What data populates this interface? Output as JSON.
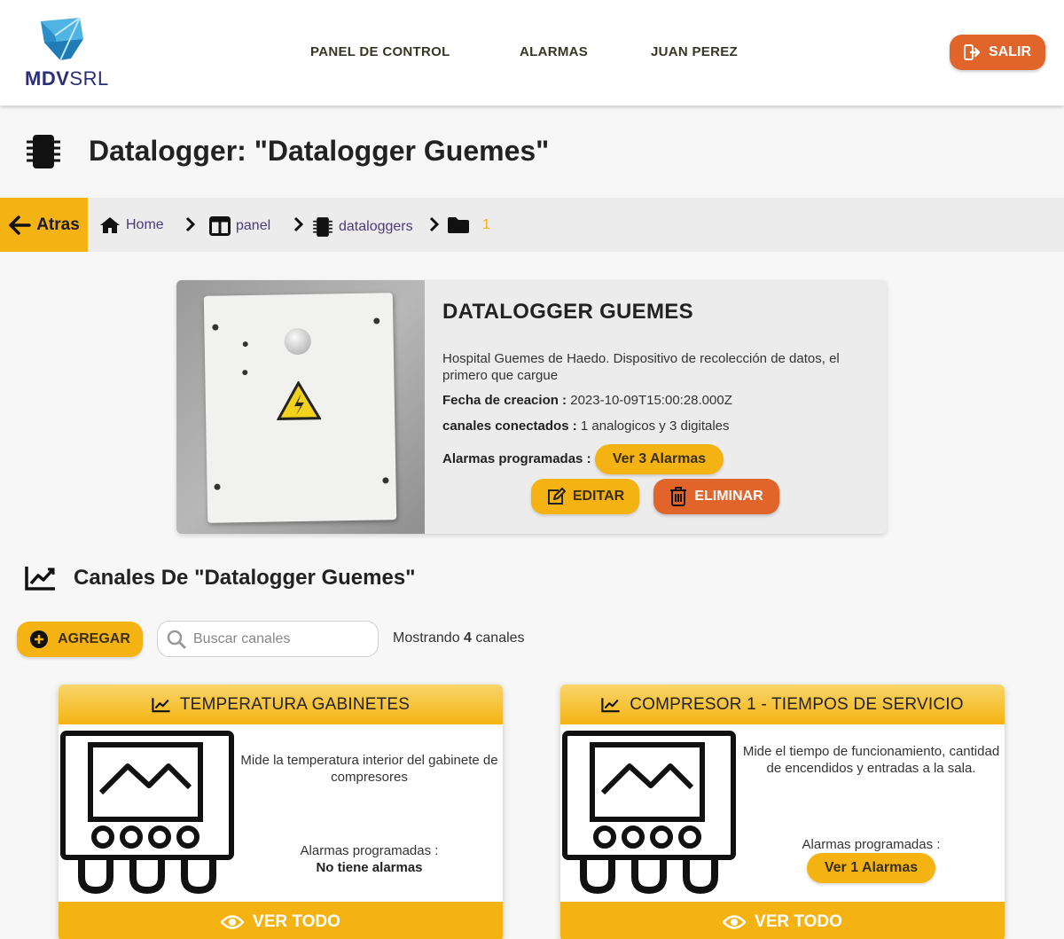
{
  "header": {
    "logo_text_bold": "MDV",
    "logo_text_light": "SRL",
    "nav": [
      "PANEL DE CONTROL",
      "ALARMAS",
      "JUAN PEREZ"
    ],
    "logout_label": "SALIR"
  },
  "page": {
    "title": "Datalogger: \"Datalogger Guemes\""
  },
  "breadcrumb": {
    "back_label": "Atras",
    "items": [
      "Home",
      "panel",
      "dataloggers",
      "1"
    ]
  },
  "device": {
    "name": "DATALOGGER GUEMES",
    "description": "Hospital Guemes de Haedo. Dispositivo de recolección de datos, el primero que cargue",
    "created_label": "Fecha de creacion :",
    "created_value": "2023-10-09T15:00:28.000Z",
    "channels_label": "canales conectados :",
    "channels_value": "1 analogicos y 3 digitales",
    "alarms_label": "Alarmas programadas :",
    "alarms_button": "Ver 3 Alarmas",
    "edit_label": "EDITAR",
    "delete_label": "ELIMINAR"
  },
  "channels_section": {
    "title": "Canales De \"Datalogger Guemes\"",
    "add_label": "AGREGAR",
    "search_placeholder": "Buscar canales",
    "showing_prefix": "Mostrando",
    "showing_count": "4",
    "showing_suffix": "canales"
  },
  "channels": [
    {
      "title": "TEMPERATURA GABINETES",
      "description": "Mide la temperatura interior del gabinete de compresores",
      "alarms_label": "Alarmas programadas :",
      "alarms_value": "No tiene alarmas",
      "view_all": "VER TODO"
    },
    {
      "title": "COMPRESOR 1 - TIEMPOS DE SERVICIO",
      "description": "Mide el tiempo de funcionamiento, cantidad de encendidos y entradas a la sala.",
      "alarms_label": "Alarmas programadas :",
      "alarms_button": "Ver 1 Alarmas",
      "view_all": "VER TODO"
    }
  ],
  "colors": {
    "accent_yellow": "#f4b312",
    "accent_orange": "#e1642a",
    "link_purple": "#4b3b7a"
  }
}
